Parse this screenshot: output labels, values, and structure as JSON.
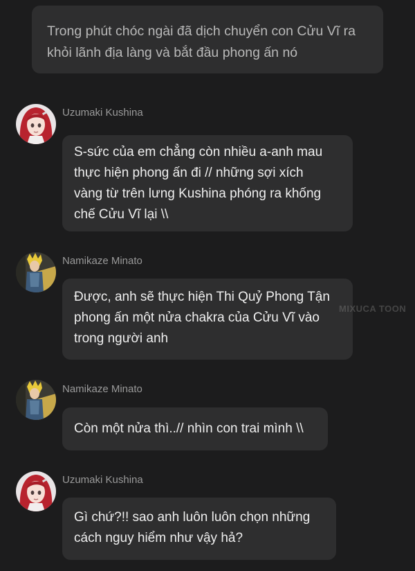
{
  "narration": {
    "lines": [
      "Trong phút chóc ngài đã dịch chuyển con Cửu Vĩ ra",
      "khỏi lãnh địa làng và bắt đầu phong ấn nó"
    ]
  },
  "messages": [
    {
      "sender": "Uzumaki Kushina",
      "avatar_icon": "kushina-avatar",
      "lines": [
        "S-sức của em chẳng còn nhiều a-anh mau",
        "thực hiện phong ấn đi // những sợi xích",
        "vàng từ trên lưng Kushina phóng ra khống",
        "chế Cửu Vĩ lại \\\\"
      ]
    },
    {
      "sender": "Namikaze Minato",
      "avatar_icon": "minato-avatar",
      "lines": [
        "Được, anh sẽ thực hiện Thi Quỷ Phong Tận",
        "phong ấn một nửa chakra của Cửu Vĩ vào",
        "trong người anh"
      ]
    },
    {
      "sender": "Namikaze Minato",
      "avatar_icon": "minato-avatar",
      "lines": [
        "Còn một nửa thì..// nhìn con trai mình \\\\"
      ]
    },
    {
      "sender": "Uzumaki Kushina",
      "avatar_icon": "kushina-avatar",
      "lines": [
        "Gì chứ?!! sao anh luôn luôn chọn những",
        "cách nguy hiểm như vậy hả?"
      ]
    }
  ],
  "watermark": "MIXUCA TOON"
}
